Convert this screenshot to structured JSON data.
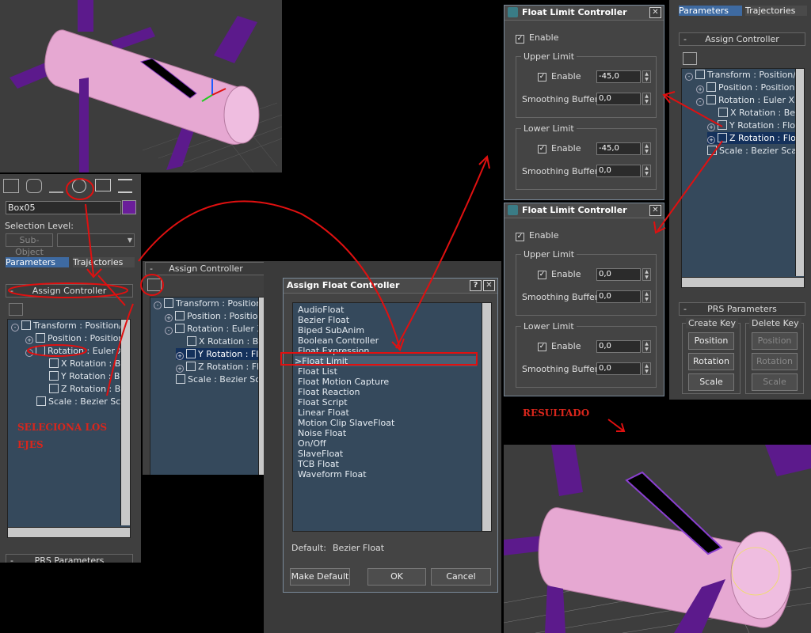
{
  "main_panel": {
    "object_name": "Box05",
    "selection_level_label": "Selection Level:",
    "subobject_label": "Sub-Object",
    "tabs": [
      "Parameters",
      "Trajectories"
    ],
    "assign_controller_title": "Assign Controller",
    "prs_title": "PRS Parameters",
    "tree": [
      "Transform : Position/R",
      "Position : Position",
      "Rotation : Euler X",
      "X Rotation : Be",
      "Y Rotation : Be",
      "Z Rotation : Be",
      "Scale : Bezier Sca"
    ]
  },
  "middle_panel": {
    "title": "Assign Controller",
    "tree": [
      "Transform : Position/R",
      "Position : Position",
      "Rotation : Euler X",
      "X Rotation : Be",
      "Y Rotation : Flo",
      "Z Rotation : Flo",
      "Scale : Bezier Sca"
    ]
  },
  "assign_float_dialog": {
    "title": "Assign Float Controller",
    "help_label": "?",
    "close_label": "✕",
    "selected_item": ">Float Limit",
    "items": [
      "AudioFloat",
      "Bezier Float",
      "Biped SubAnim",
      "Boolean Controller",
      "Float Expression",
      "Float Limit",
      "Float List",
      "Float Motion Capture",
      "Float Reaction",
      "Float Script",
      "Linear Float",
      "Motion Clip SlaveFloat",
      "Noise Float",
      "On/Off",
      "SlaveFloat",
      "TCB Float",
      "Waveform Float"
    ],
    "default_label": "Default:",
    "default_value": "Bezier Float",
    "make_default_label": "Make Default",
    "ok_label": "OK",
    "cancel_label": "Cancel"
  },
  "float_limit_dialog_1": {
    "title": "Float Limit Controller",
    "enable_label": "Enable",
    "upper_group": "Upper Limit",
    "upper_enable": "Enable",
    "upper_value": "-45,0",
    "upper_smoothing_label": "Smoothing Buffer:",
    "upper_smoothing_value": "0,0",
    "lower_group": "Lower Limit",
    "lower_enable": "Enable",
    "lower_value": "-45,0",
    "lower_smoothing_label": "Smoothing Buffer:",
    "lower_smoothing_value": "0,0"
  },
  "float_limit_dialog_2": {
    "title": "Float Limit Controller",
    "enable_label": "Enable",
    "upper_group": "Upper Limit",
    "upper_enable": "Enable",
    "upper_value": "0,0",
    "upper_smoothing_label": "Smoothing Buffer:",
    "upper_smoothing_value": "0,0",
    "lower_group": "Lower Limit",
    "lower_enable": "Enable",
    "lower_value": "0,0",
    "lower_smoothing_label": "Smoothing Buffer:",
    "lower_smoothing_value": "0,0"
  },
  "right_panel": {
    "tabs": [
      "Parameters",
      "Trajectories"
    ],
    "assign_controller_title": "Assign Controller",
    "prs_title": "PRS Parameters",
    "create_key_label": "Create Key",
    "delete_key_label": "Delete Key",
    "create_buttons": [
      "Position",
      "Rotation",
      "Scale"
    ],
    "delete_buttons": [
      "Position",
      "Rotation",
      "Scale"
    ],
    "tree": [
      "Transform : Position/R",
      "Position : Position",
      "Rotation : Euler X",
      "X Rotation : Be",
      "Y Rotation : Flo",
      "Z Rotation : Flo",
      "Scale : Bezier Sca"
    ]
  },
  "annotations": {
    "selecciona_line1": "SELECIONA LOS",
    "selecciona_line2": "EJES",
    "resultado": "RESULTADO"
  },
  "colors": {
    "accent_blue": "#3e6aa1",
    "annotation_red": "#e01010",
    "cylinder_pink": "#e6a8d2",
    "purple": "#5c1a8c"
  }
}
